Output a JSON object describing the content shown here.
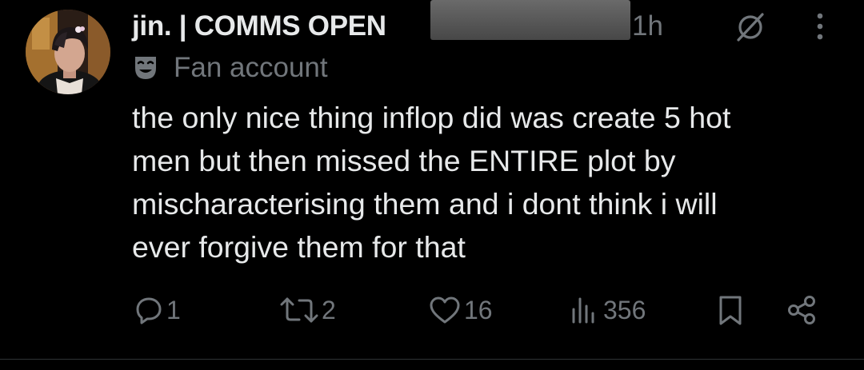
{
  "post": {
    "display_name": "jin. | COMMS OPEN",
    "timestamp": "1h",
    "label": "Fan account",
    "text_lines": [
      "the only nice thing inflop did was create 5 hot",
      "men but then missed the ENTIRE plot by",
      "mischaracterising them and i dont think i will",
      "ever forgive them for that"
    ]
  },
  "actions": {
    "replies": "1",
    "reposts": "2",
    "likes": "16",
    "views": "356"
  },
  "icons": {
    "avatar": "profile-avatar",
    "grok": "grok-icon",
    "more": "more-icon",
    "label": "theater-mask-icon",
    "reply": "reply-icon",
    "repost": "repost-icon",
    "like": "heart-icon",
    "views": "analytics-icon",
    "bookmark": "bookmark-icon",
    "share": "share-icon"
  },
  "colors": {
    "background": "#000000",
    "primary_text": "#e7e9ea",
    "secondary_text": "#71767b",
    "divider": "#2f3336"
  }
}
